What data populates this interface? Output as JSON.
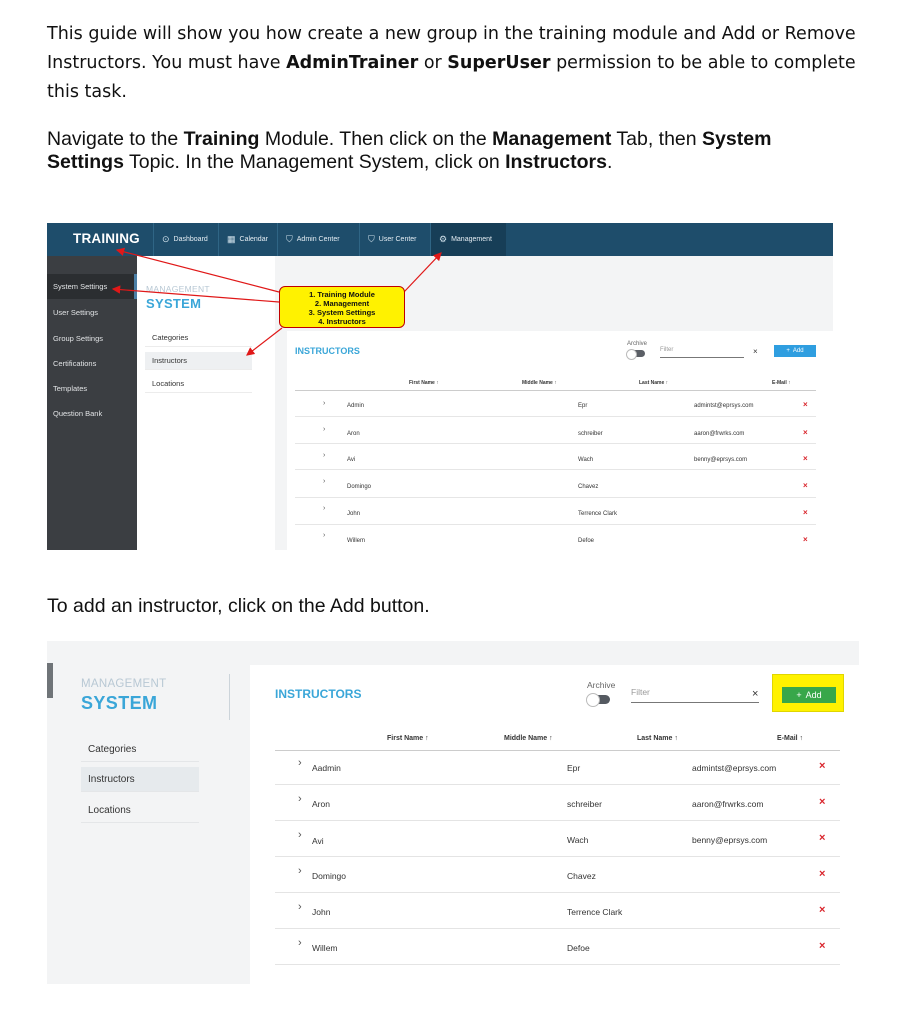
{
  "intro": {
    "line1": "This guide will show you how create a new group in the training module and Add or Remove",
    "line2_pre": "Instructors. You must have ",
    "perm1": "AdminTrainer",
    "or": " or ",
    "perm2": "SuperUser",
    "line2_post": " permission to be able to complete",
    "line3": "this task."
  },
  "nav_paragraph": {
    "t1": "Navigate to the ",
    "b1": "Training",
    "t2": " Module. Then click on the ",
    "b2": "Management",
    "t3": " Tab, then ",
    "b3": "System",
    "b4": "Settings",
    "t4": " Topic. In the Management System, click on ",
    "b5": "Instructors",
    "t5": "."
  },
  "add_paragraph": "To add an instructor, click on the Add button.",
  "screenshot1": {
    "brand": "TRAINING",
    "nav": [
      {
        "label": "Dashboard",
        "icon": "⊙"
      },
      {
        "label": "Calendar",
        "icon": "▦"
      },
      {
        "label": "Admin Center",
        "icon": "⛉"
      },
      {
        "label": "User Center",
        "icon": "⛉"
      },
      {
        "label": "Management",
        "icon": "⚙"
      }
    ],
    "sidebar": [
      "System Settings",
      "User Settings",
      "Group Settings",
      "Certifications",
      "Templates",
      "Question Bank"
    ],
    "management": "MANAGEMENT",
    "system": "SYSTEM",
    "menu": [
      "Categories",
      "Instructors",
      "Locations"
    ],
    "callout": [
      "1. Training Module",
      "2. Management",
      "3. System Settings",
      "4. Instructors"
    ]
  },
  "screenshot2": {
    "management": "MANAGEMENT",
    "system": "SYSTEM",
    "menu": [
      "Categories",
      "Instructors",
      "Locations"
    ]
  },
  "table": {
    "title": "INSTRUCTORS",
    "archive": "Archive",
    "filter_placeholder": "Filter",
    "clear": "×",
    "add_label": "Add",
    "add_icon": "+",
    "columns": [
      "First Name ↑",
      "Middle Name ↑",
      "Last Name ↑",
      "E-Mail ↑"
    ],
    "rows1": [
      {
        "first": "Admin",
        "last": "Epr",
        "email": "admintst@eprsys.com"
      },
      {
        "first": "Aron",
        "last": "schreiber",
        "email": "aaron@frwrks.com"
      },
      {
        "first": "Avi",
        "last": "Wach",
        "email": "benny@eprsys.com"
      },
      {
        "first": "Domingo",
        "last": "Chavez",
        "email": ""
      },
      {
        "first": "John",
        "last": "Terrence Clark",
        "email": ""
      },
      {
        "first": "Willem",
        "last": "Defoe",
        "email": ""
      }
    ],
    "rows2": [
      {
        "first": "Aadmin",
        "last": "Epr",
        "email": "admintst@eprsys.com"
      },
      {
        "first": "Aron",
        "last": "schreiber",
        "email": "aaron@frwrks.com"
      },
      {
        "first": "Avi",
        "last": "Wach",
        "email": "benny@eprsys.com"
      },
      {
        "first": "Domingo",
        "last": "Chavez",
        "email": ""
      },
      {
        "first": "John",
        "last": "Terrence Clark",
        "email": ""
      },
      {
        "first": "Willem",
        "last": "Defoe",
        "email": ""
      }
    ],
    "expand_icon": "›",
    "delete_icon": "×"
  }
}
